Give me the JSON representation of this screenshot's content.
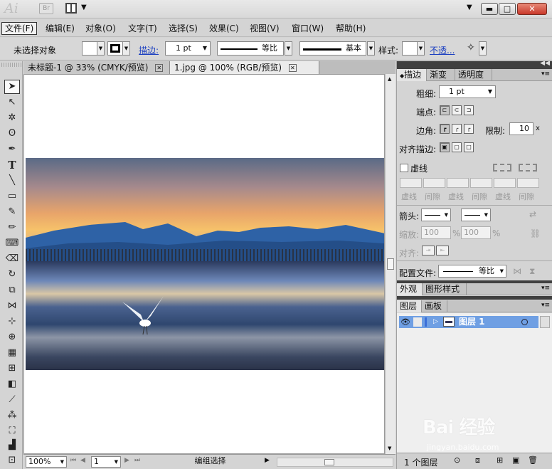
{
  "title_bar": {
    "logo": "Ai",
    "bridge_label": "Br",
    "minimize_glyph": "▬",
    "maximize_glyph": "□",
    "close_glyph": "✕",
    "dropdown_glyph": "▼"
  },
  "menu": [
    "文件(F)",
    "编辑(E)",
    "对象(O)",
    "文字(T)",
    "选择(S)",
    "效果(C)",
    "视图(V)",
    "窗口(W)",
    "帮助(H)"
  ],
  "control_bar": {
    "selection_status": "未选择对象",
    "stroke_link": "描边:",
    "stroke_weight": "1 pt",
    "profile_label": "等比",
    "brush_label": "基本",
    "style_label": "样式:",
    "opacity_link": "不透..."
  },
  "document_tabs": [
    {
      "label": "未标题-1 @ 33% (CMYK/预览)",
      "close": "✕"
    },
    {
      "label": "1.jpg @ 100% (RGB/预览)",
      "close": "✕"
    }
  ],
  "status_bar": {
    "zoom": "100%",
    "artboard": "1",
    "tool_status": "编组选择",
    "nav_first": "⏮",
    "nav_prev": "◀",
    "nav_next": "▶",
    "nav_last": "⏭",
    "dropdown_glyph": "▼",
    "play_glyph": "▶"
  },
  "stroke_panel": {
    "tabs": [
      "描边",
      "渐变",
      "透明度"
    ],
    "weight_label": "粗细:",
    "weight_value": "1 pt",
    "cap_label": "端点:",
    "corner_label": "边角:",
    "limit_label": "限制:",
    "limit_value": "10",
    "limit_unit": "x",
    "align_label": "对齐描边:",
    "dashed_label": "虚线",
    "dash_labels": [
      "虚线",
      "间隙",
      "虚线",
      "间隙",
      "虚线",
      "间隙"
    ],
    "arrow_label": "箭头:",
    "scale_label": "缩放:",
    "scale_value_1": "100",
    "scale_value_2": "100",
    "percent": "%",
    "align_arrow_label": "对齐:",
    "profile_label": "配置文件:",
    "profile_value": "等比"
  },
  "appearance_panel": {
    "tabs": [
      "外观",
      "图形样式"
    ]
  },
  "layers_panel": {
    "tabs": [
      "图层",
      "画板"
    ],
    "layer_name": "图层 1",
    "footer_count": "1 个图层"
  },
  "watermark": {
    "brand": "Bai 经验",
    "url": "jingyan.baidu.com"
  }
}
